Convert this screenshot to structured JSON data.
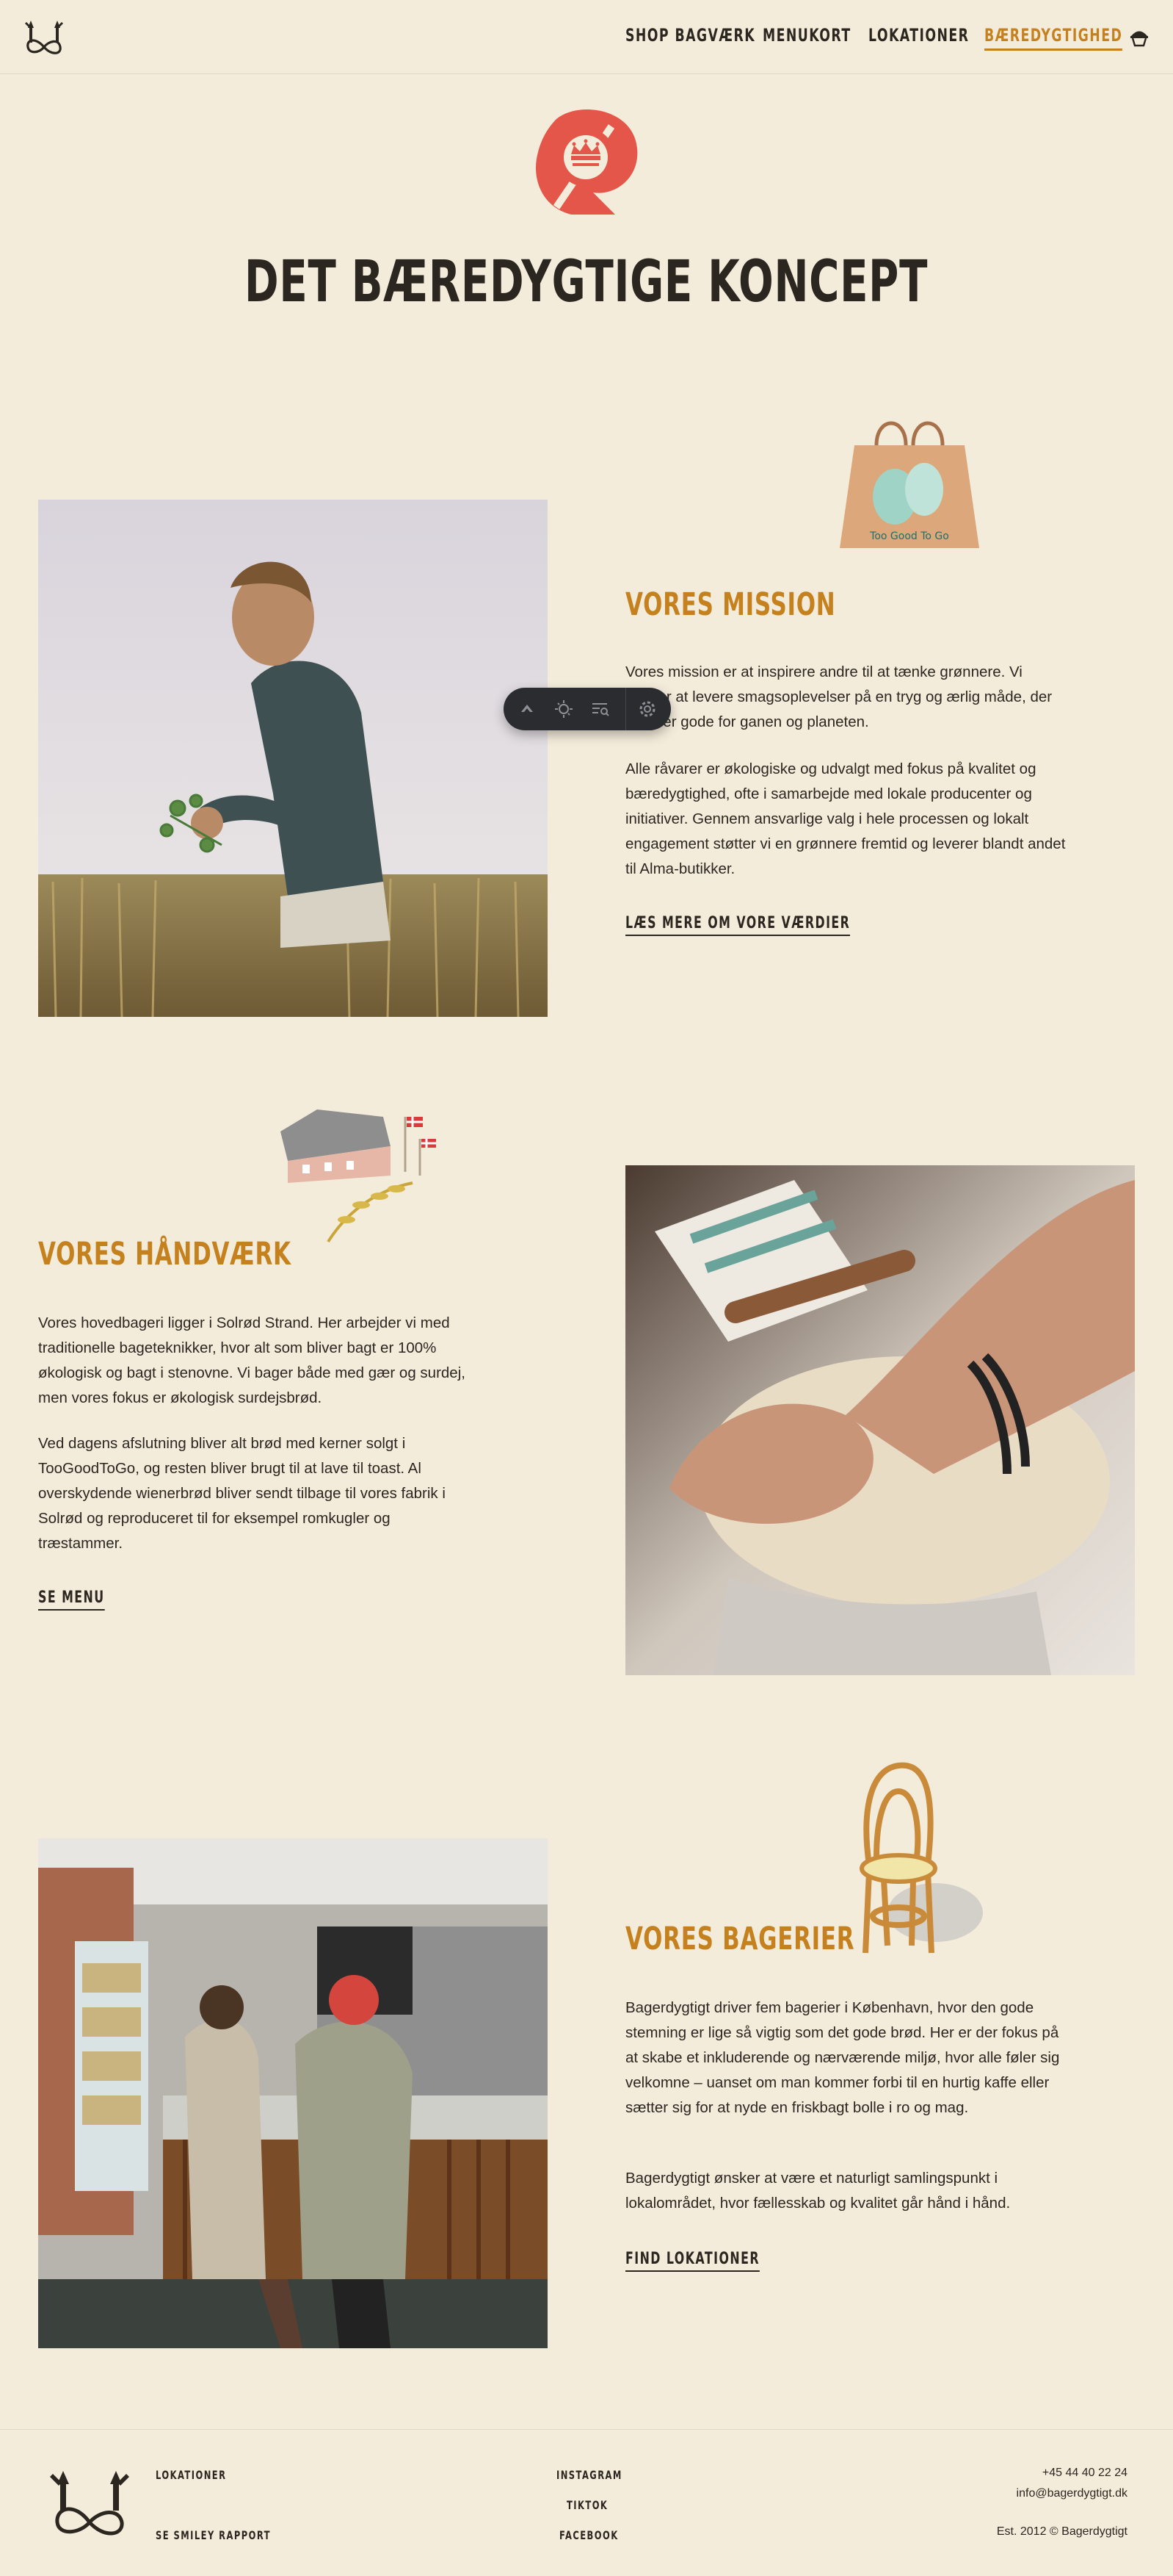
{
  "nav": {
    "items": [
      {
        "label": "SHOP BAGVÆRK",
        "active": false
      },
      {
        "label": "MENUKORT",
        "active": false
      },
      {
        "label": "LOKATIONER",
        "active": false
      },
      {
        "label": "BÆREDYGTIGHED",
        "active": true
      }
    ],
    "basket_icon": "basket-icon",
    "logo_icon": "pretzel-wheat-logo"
  },
  "colors": {
    "background": "#f4ecdb",
    "accent": "#c6811f",
    "text": "#2b2720",
    "emblem": "#e5564a"
  },
  "hero": {
    "emblem_icon": "organic-crown-emblem",
    "title": "DET BÆREDYGTIGE KONCEPT"
  },
  "mission": {
    "title": "VORES MISSION",
    "p1": "Vores mission er at inspirere andre til at tænke grønnere. Vi ønsker at levere smagsoplevelser på en tryg og ærlig måde, der både er gode for ganen og planeten.",
    "p2": "Alle råvarer er økologiske og udvalgt med fokus på kvalitet og bæredygtighed, ofte i samarbejde med lokale producenter og initiativer. Gennem ansvarlige valg i hele processen og lokalt engagement støtter vi en grønnere fremtid og leverer blandt andet til Alma-butikker.",
    "cta": "LÆS MERE OM VORE VÆRDIER",
    "bag_text": "Too Good To Go"
  },
  "craft": {
    "title": "VORES HÅNDVÆRK",
    "p1": "Vores hovedbageri ligger i Solrød Strand. Her arbejder vi med traditionelle bageteknikker, hvor alt som bliver bagt er 100% økologisk og bagt i stenovne. Vi bager både med gær og surdej, men vores fokus er økologisk surdejsbrød.",
    "p2": "Ved dagens afslutning bliver alt brød med kerner solgt i TooGoodToGo, og resten bliver brugt til at lave til toast. Al overskydende wienerbrød bliver sendt tilbage til vores fabrik i Solrød og reproduceret til for eksempel romkugler og træstammer.",
    "cta": "SE MENU"
  },
  "bakeries": {
    "title": "VORES BAGERIER",
    "p1": "Bagerdygtigt driver fem bagerier i København, hvor den gode stemning er lige så vigtig som det gode brød. Her er der fokus på at skabe et inkluderende og nærværende miljø, hvor alle føler sig velkomne – uanset om man kommer forbi til en hurtig kaffe eller sætter sig for at nyde en friskbagt bolle i ro og mag.",
    "p2": "Bagerdygtigt ønsker at være et naturligt samlingspunkt i lokalområdet, hvor fællesskab og kvalitet går hånd i hånd.",
    "cta": "FIND LOKATIONER"
  },
  "toolbar": {
    "icons": [
      "arrow-up-icon",
      "brightness-icon",
      "search-list-icon",
      "settings-icon"
    ]
  },
  "footer": {
    "left_links": [
      "LOKATIONER",
      "SE SMILEY RAPPORT"
    ],
    "social_links": [
      "INSTAGRAM",
      "TIKTOK",
      "FACEBOOK"
    ],
    "phone": "+45 44 40 22 24",
    "email": "info@bagerdygtigt.dk",
    "est": "Est. 2012 © Bagerdygtigt"
  }
}
